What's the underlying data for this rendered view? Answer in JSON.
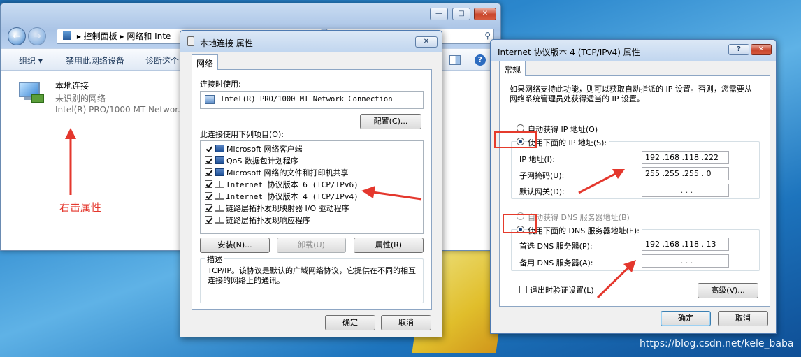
{
  "explorer": {
    "breadcrumb": [
      "控制面板",
      "网络和 Inte"
    ],
    "toolbar": {
      "organize": "组织 ▾",
      "disable": "禁用此网络设备",
      "diagnose": "诊断这个"
    },
    "adapter": {
      "name": "本地连接",
      "status": "未识别的网络",
      "device": "Intel(R) PRO/1000 MT Networ..."
    }
  },
  "annotation": {
    "right_click": "右击属性"
  },
  "props": {
    "title": "本地连接 属性",
    "tab": "网络",
    "connect_using_label": "连接时使用:",
    "adapter_name": "Intel(R) PRO/1000 MT Network Connection",
    "configure_button": "配置(C)...",
    "items_label": "此连接使用下列项目(O):",
    "items": [
      {
        "label": "Microsoft 网络客户端",
        "icon": "network-client-icon"
      },
      {
        "label": "QoS 数据包计划程序",
        "icon": "qos-icon"
      },
      {
        "label": "Microsoft 网络的文件和打印机共享",
        "icon": "file-share-icon"
      },
      {
        "label": "Internet 协议版本 6 (TCP/IPv6)",
        "icon": "protocol-icon"
      },
      {
        "label": "Internet 协议版本 4 (TCP/IPv4)",
        "icon": "protocol-icon"
      },
      {
        "label": "链路层拓扑发现映射器 I/O 驱动程序",
        "icon": "protocol-icon"
      },
      {
        "label": "链路层拓扑发现响应程序",
        "icon": "protocol-icon"
      }
    ],
    "install_button": "安装(N)...",
    "uninstall_button": "卸载(U)",
    "properties_button": "属性(R)",
    "description_label": "描述",
    "description_text": "TCP/IP。该协议是默认的广域网络协议，它提供在不同的相互连接的网络上的通讯。",
    "ok_button": "确定",
    "cancel_button": "取消"
  },
  "ipv4": {
    "title": "Internet 协议版本 4 (TCP/IPv4) 属性",
    "help_button": "?",
    "tab": "常规",
    "intro": "如果网络支持此功能，则可以获取自动指派的 IP 设置。否则，您需要从网络系统管理员处获得适当的 IP 设置。",
    "auto_ip": "自动获得 IP 地址(O)",
    "manual_ip": "使用下面的 IP 地址(S):",
    "ip_label": "IP 地址(I):",
    "ip_value": "192 .168 .118 .222",
    "mask_label": "子网掩码(U):",
    "mask_value": "255 .255 .255 . 0",
    "gateway_label": "默认网关(D):",
    "gateway_value": ".     .     .",
    "auto_dns": "自动获得 DNS 服务器地址(B)",
    "manual_dns": "使用下面的 DNS 服务器地址(E):",
    "dns1_label": "首选 DNS 服务器(P):",
    "dns1_value": "192 .168 .118 . 13",
    "dns2_label": "备用 DNS 服务器(A):",
    "dns2_value": ".     .     .",
    "validate_label": "退出时验证设置(L)",
    "advanced_button": "高级(V)...",
    "ok_button": "确定",
    "cancel_button": "取消"
  },
  "watermark": "https://blog.csdn.net/kele_baba",
  "colors": {
    "annotation_red": "#e4372d",
    "titlebar": "#c1d6ef"
  }
}
